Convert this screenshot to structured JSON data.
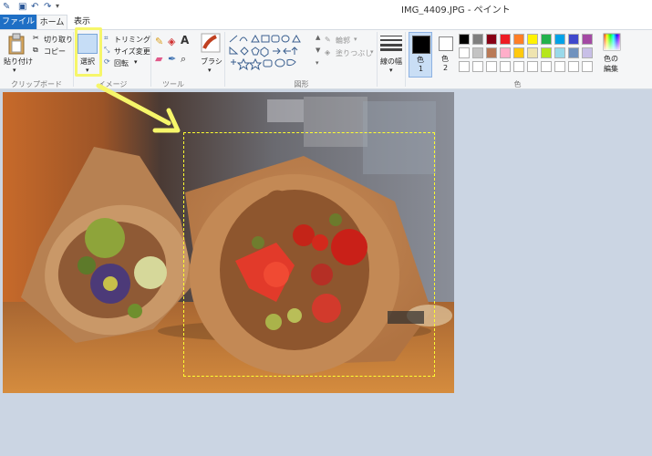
{
  "title_bar": {
    "title": "IMG_4409.JPG - ペイント"
  },
  "tabs": {
    "file": "ファイル",
    "home": "ホーム",
    "view": "表示"
  },
  "clipboard": {
    "paste": "貼り付け",
    "cut": "切り取り",
    "copy": "コピー",
    "group": "クリップボード"
  },
  "image": {
    "select": "選択",
    "crop": "トリミング",
    "resize": "サイズ変更",
    "rotate": "回転",
    "group": "イメージ"
  },
  "tools": {
    "group": "ツール"
  },
  "brushes": {
    "label": "ブラシ"
  },
  "shapes": {
    "outline": "輪郭",
    "fill": "塗りつぶし",
    "group": "図形"
  },
  "size": {
    "label": "線の幅"
  },
  "color1": {
    "label": "色",
    "num": "1"
  },
  "color2": {
    "label": "色",
    "num": "2"
  },
  "colors": {
    "group": "色",
    "edit_line1": "色の",
    "edit_line2": "編集",
    "row1": [
      "#000000",
      "#7f7f7f",
      "#880015",
      "#ed1c24",
      "#ff7f27",
      "#fff200",
      "#22b14c",
      "#00a2e8",
      "#3f48cc",
      "#a349a4"
    ],
    "row2": [
      "#ffffff",
      "#c3c3c3",
      "#b97a57",
      "#ffaec9",
      "#ffc90e",
      "#efe4b0",
      "#b5e61d",
      "#99d9ea",
      "#7092be",
      "#c8bfe7"
    ],
    "row3": [
      "#ffffff",
      "#ffffff",
      "#ffffff",
      "#ffffff",
      "#ffffff",
      "#ffffff",
      "#ffffff",
      "#ffffff",
      "#ffffff",
      "#ffffff"
    ],
    "primary": "#000000",
    "secondary": "#ffffff",
    "accent_tab": "#1e6fc5",
    "annotation": "#f6f66a"
  }
}
